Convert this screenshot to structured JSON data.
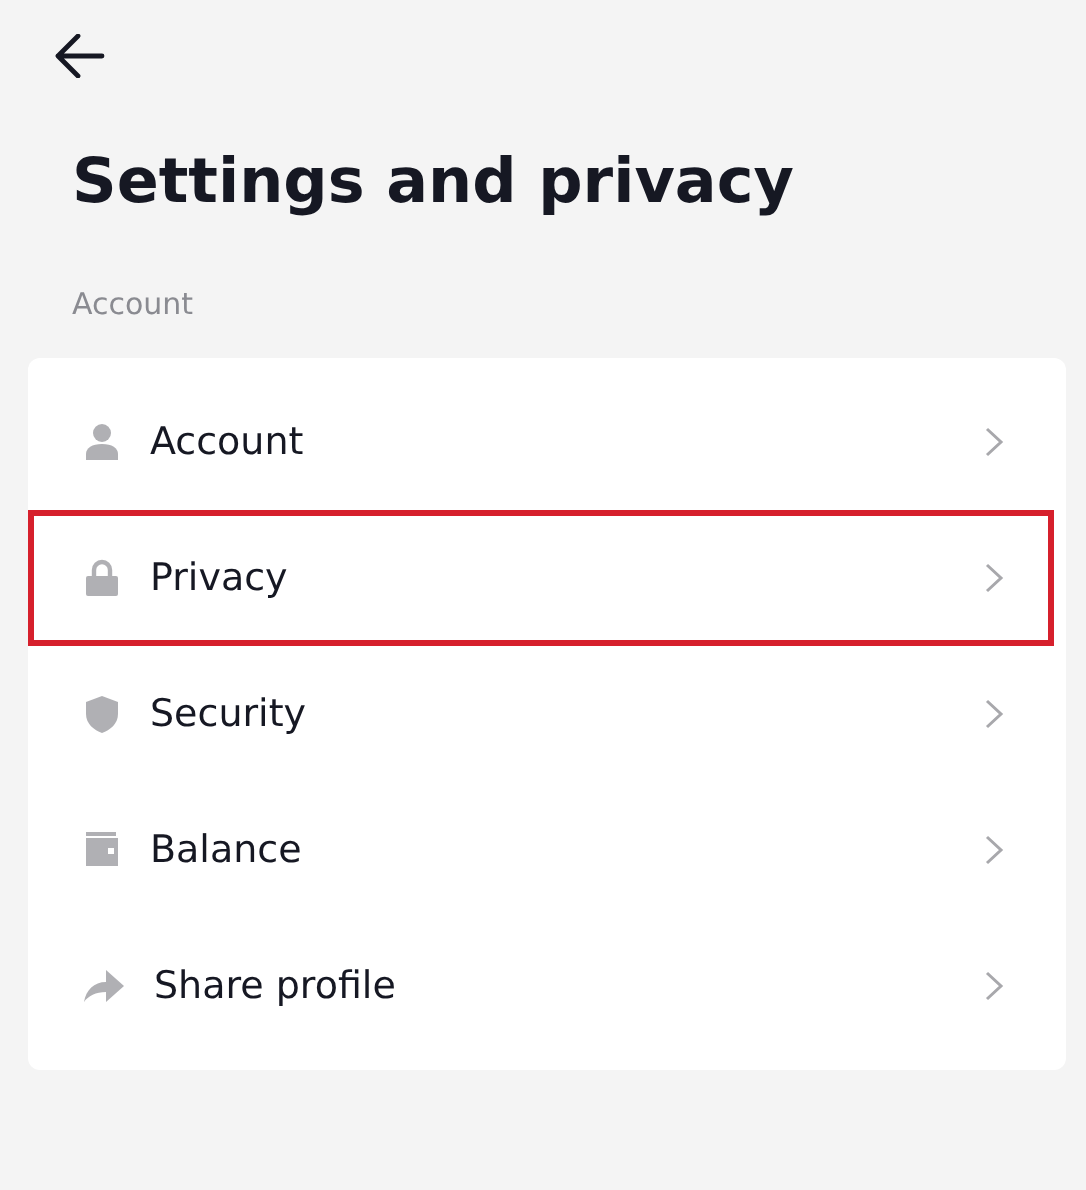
{
  "title": "Settings and privacy",
  "section": {
    "label": "Account",
    "items": [
      {
        "kind": "person",
        "label": "Account",
        "highlighted": false
      },
      {
        "kind": "lock",
        "label": "Privacy",
        "highlighted": true
      },
      {
        "kind": "shield",
        "label": "Security",
        "highlighted": false
      },
      {
        "kind": "wallet",
        "label": "Balance",
        "highlighted": false
      },
      {
        "kind": "share",
        "label": "Share profile",
        "highlighted": false
      }
    ]
  }
}
